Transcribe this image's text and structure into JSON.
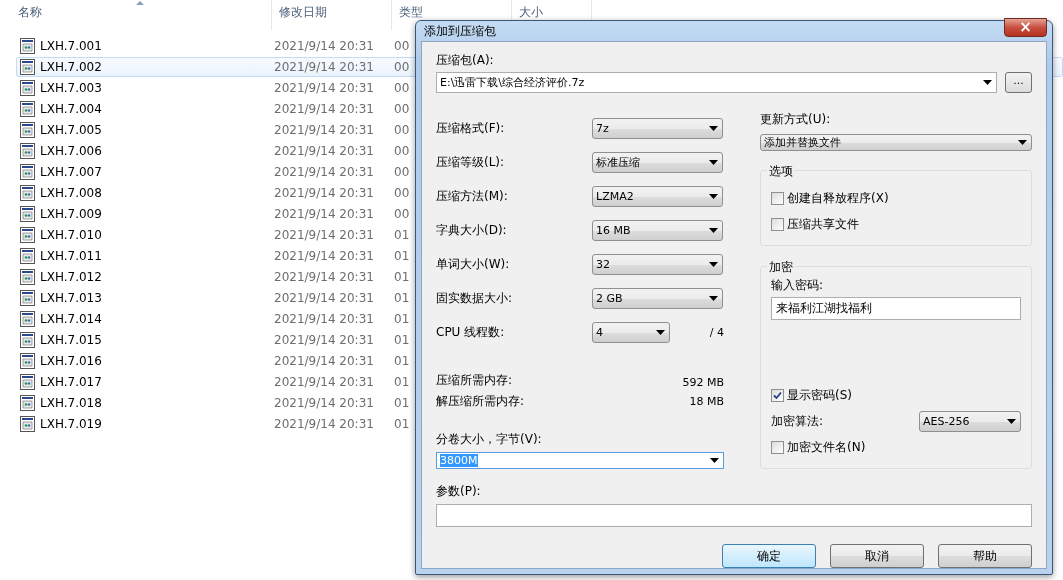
{
  "explorer": {
    "columns": [
      {
        "label": "名称",
        "sorted": true
      },
      {
        "label": "修改日期",
        "sorted": false
      },
      {
        "label": "类型",
        "sorted": false
      },
      {
        "label": "大小",
        "sorted": false
      }
    ],
    "files": [
      {
        "name": "LXH.7.001",
        "date": "2021/9/14 20:31",
        "type": "00",
        "selected": false
      },
      {
        "name": "LXH.7.002",
        "date": "2021/9/14 20:31",
        "type": "00",
        "selected": true
      },
      {
        "name": "LXH.7.003",
        "date": "2021/9/14 20:31",
        "type": "00",
        "selected": false
      },
      {
        "name": "LXH.7.004",
        "date": "2021/9/14 20:31",
        "type": "00",
        "selected": false
      },
      {
        "name": "LXH.7.005",
        "date": "2021/9/14 20:31",
        "type": "00",
        "selected": false
      },
      {
        "name": "LXH.7.006",
        "date": "2021/9/14 20:31",
        "type": "00",
        "selected": false
      },
      {
        "name": "LXH.7.007",
        "date": "2021/9/14 20:31",
        "type": "00",
        "selected": false
      },
      {
        "name": "LXH.7.008",
        "date": "2021/9/14 20:31",
        "type": "00",
        "selected": false
      },
      {
        "name": "LXH.7.009",
        "date": "2021/9/14 20:31",
        "type": "00",
        "selected": false
      },
      {
        "name": "LXH.7.010",
        "date": "2021/9/14 20:31",
        "type": "01",
        "selected": false
      },
      {
        "name": "LXH.7.011",
        "date": "2021/9/14 20:31",
        "type": "01",
        "selected": false
      },
      {
        "name": "LXH.7.012",
        "date": "2021/9/14 20:31",
        "type": "01",
        "selected": false
      },
      {
        "name": "LXH.7.013",
        "date": "2021/9/14 20:31",
        "type": "01",
        "selected": false
      },
      {
        "name": "LXH.7.014",
        "date": "2021/9/14 20:31",
        "type": "01",
        "selected": false
      },
      {
        "name": "LXH.7.015",
        "date": "2021/9/14 20:31",
        "type": "01",
        "selected": false
      },
      {
        "name": "LXH.7.016",
        "date": "2021/9/14 20:31",
        "type": "01",
        "selected": false
      },
      {
        "name": "LXH.7.017",
        "date": "2021/9/14 20:31",
        "type": "01",
        "selected": false
      },
      {
        "name": "LXH.7.018",
        "date": "2021/9/14 20:31",
        "type": "01",
        "selected": false
      },
      {
        "name": "LXH.7.019",
        "date": "2021/9/14 20:31",
        "type": "01",
        "selected": false
      }
    ]
  },
  "dialog": {
    "title": "添加到压缩包",
    "close": "×",
    "archive": {
      "label": "压缩包(A):",
      "value": "E:\\迅雷下载\\综合经济评价.7z",
      "browse": "..."
    },
    "settings": [
      {
        "kind": "combo",
        "label": "压缩格式(F):",
        "value": "7z"
      },
      {
        "kind": "combo",
        "label": "压缩等级(L):",
        "value": "标准压缩"
      },
      {
        "kind": "combo",
        "label": "压缩方法(M):",
        "value": "LZMA2"
      },
      {
        "kind": "combo",
        "label": "字典大小(D):",
        "value": "16 MB"
      },
      {
        "kind": "combo",
        "label": "单词大小(W):",
        "value": "32"
      },
      {
        "kind": "combo",
        "label": "固实数据大小:",
        "value": "2 GB"
      },
      {
        "kind": "small_combo",
        "label": "CPU 线程数:",
        "value": "4",
        "suffix": "/ 4"
      },
      {
        "kind": "info",
        "label": "压缩所需内存:",
        "value": "592 MB"
      },
      {
        "kind": "info",
        "label": "解压缩所需内存:",
        "value": "18 MB"
      }
    ],
    "volume": {
      "label": "分卷大小，字节(V):",
      "value": "3800M"
    },
    "parameters": {
      "label": "参数(P):"
    },
    "update": {
      "label": "更新方式(U):",
      "value": "添加并替换文件"
    },
    "options": {
      "title": "选项",
      "items": [
        {
          "label": "创建自释放程序(X)",
          "checked": false
        },
        {
          "label": "压缩共享文件",
          "checked": false
        }
      ]
    },
    "encryption": {
      "title": "加密",
      "password_label": "输入密码:",
      "password": "来福利江湖找福利",
      "show_password": {
        "label": "显示密码(S)",
        "checked": true
      },
      "method_label": "加密算法:",
      "method": "AES-256",
      "encrypt_names": {
        "label": "加密文件名(N)",
        "checked": false
      }
    },
    "buttons": [
      {
        "label": "确定",
        "default": true
      },
      {
        "label": "取消",
        "default": false
      },
      {
        "label": "帮助",
        "default": false
      }
    ]
  }
}
